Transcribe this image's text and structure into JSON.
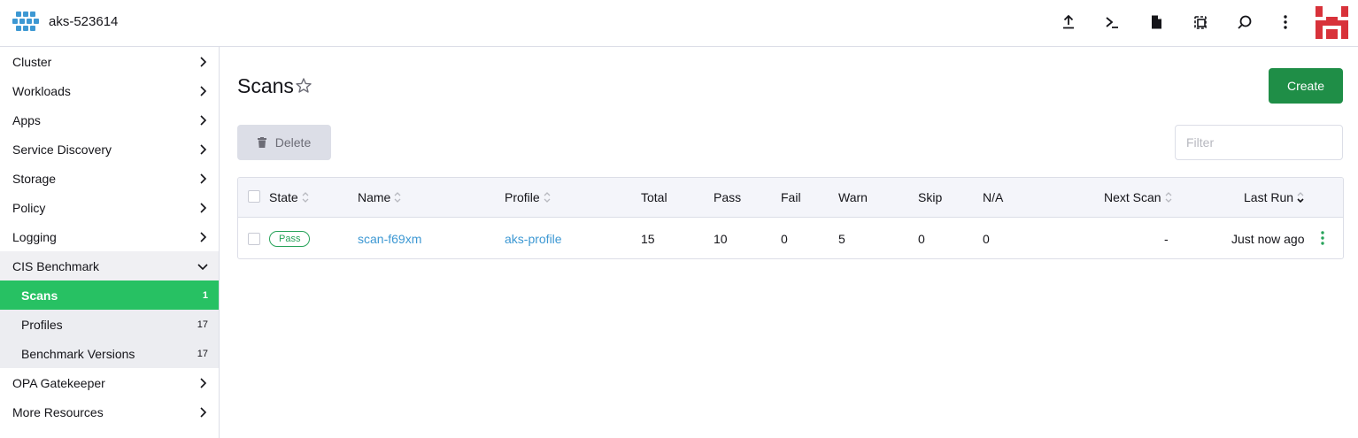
{
  "header": {
    "cluster_name": "aks-523614",
    "icons": [
      "upload-icon",
      "terminal-icon",
      "file-icon",
      "copy-config-icon",
      "search-icon",
      "more-vertical-icon"
    ]
  },
  "sidebar": {
    "items": [
      {
        "label": "Cluster"
      },
      {
        "label": "Workloads"
      },
      {
        "label": "Apps"
      },
      {
        "label": "Service Discovery"
      },
      {
        "label": "Storage"
      },
      {
        "label": "Policy"
      },
      {
        "label": "Logging"
      },
      {
        "label": "CIS Benchmark"
      },
      {
        "label": "OPA Gatekeeper"
      },
      {
        "label": "More Resources"
      }
    ],
    "sub_items": [
      {
        "label": "Scans",
        "count": "1"
      },
      {
        "label": "Profiles",
        "count": "17"
      },
      {
        "label": "Benchmark Versions",
        "count": "17"
      }
    ]
  },
  "main": {
    "title": "Scans",
    "create_label": "Create",
    "delete_label": "Delete",
    "filter_placeholder": "Filter"
  },
  "table": {
    "headers": {
      "state": "State",
      "name": "Name",
      "profile": "Profile",
      "total": "Total",
      "pass": "Pass",
      "fail": "Fail",
      "warn": "Warn",
      "skip": "Skip",
      "na": "N/A",
      "next_scan": "Next Scan",
      "last_run": "Last Run"
    },
    "rows": [
      {
        "state": "Pass",
        "name": "scan-f69xm",
        "profile": "aks-profile",
        "total": "15",
        "pass": "10",
        "fail": "0",
        "warn": "5",
        "skip": "0",
        "na": "0",
        "next_scan": "-",
        "last_run": "Just now ago"
      }
    ]
  },
  "colors": {
    "active_nav": "#27c163",
    "primary_button": "#1f8e47",
    "link": "#3d98d3",
    "pass_badge": "#27a35a"
  }
}
